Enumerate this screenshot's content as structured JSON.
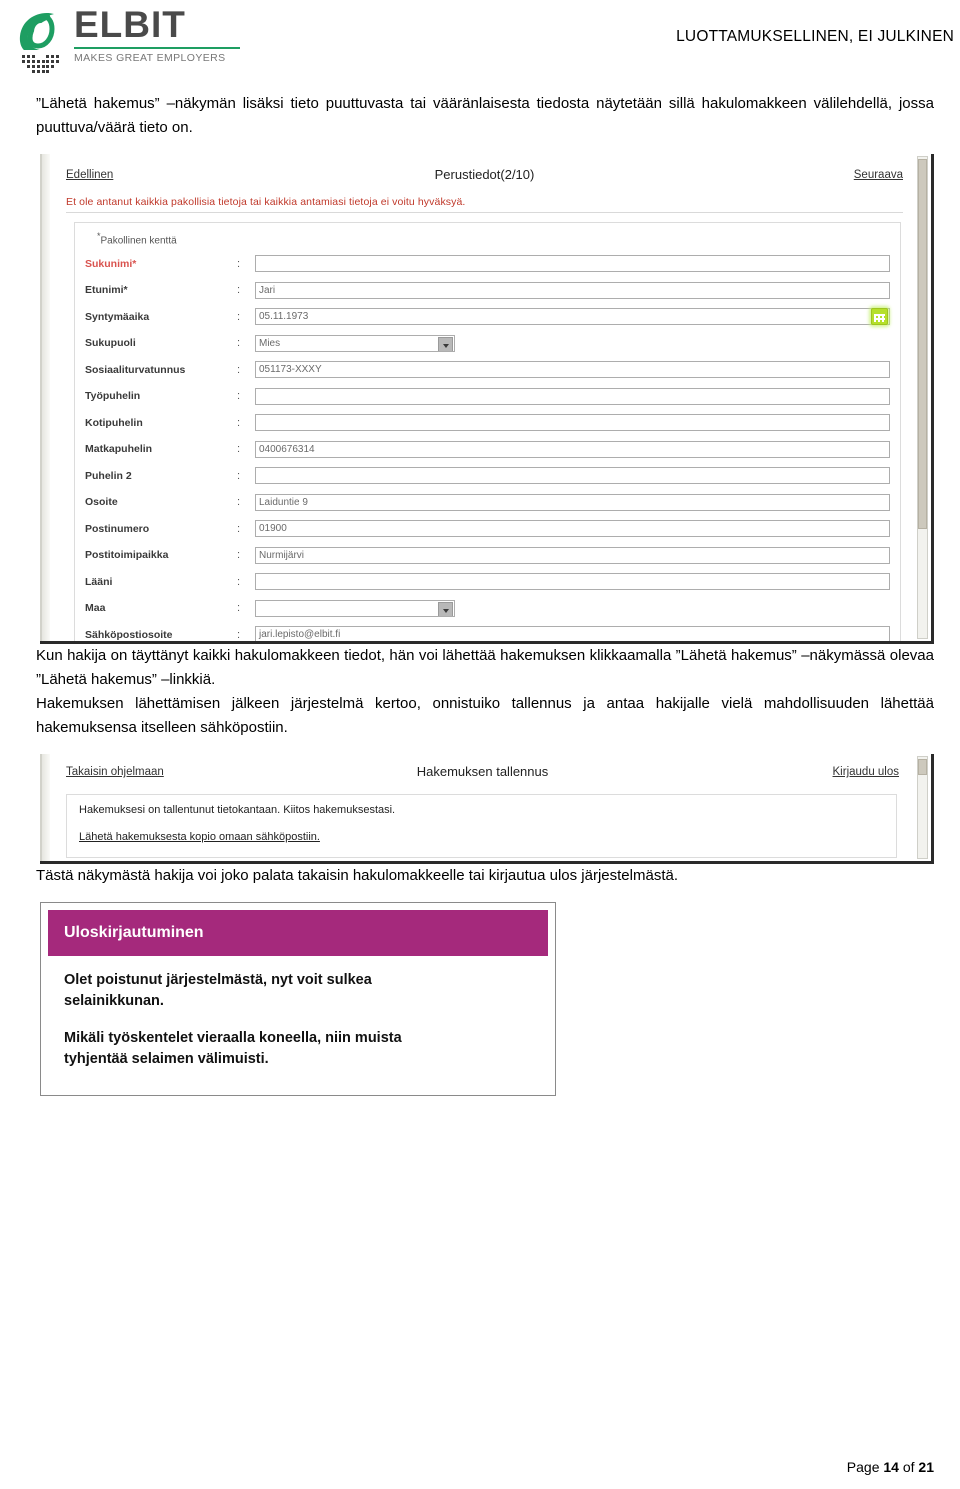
{
  "header": {
    "logo_name": "ELBIT",
    "logo_tagline": "MAKES GREAT EMPLOYERS",
    "logo_mark_icon": "elbit-e-swirl-icon",
    "classification": "LUOTTAMUKSELLINEN, EI JULKINEN",
    "brand_green": "#1e9e62",
    "brand_gray": "#4a4a4a"
  },
  "paragraphs": {
    "p1": "”Lähetä hakemus” –näkymän lisäksi tieto puuttuvasta tai vääränlaisesta tiedosta näytetään sillä hakulomakkeen välilehdellä, jossa puuttuva/väärä tieto on.",
    "p2": "Kun hakija on täyttänyt kaikki hakulomakkeen tiedot, hän voi lähettää hakemuksen klikkaamalla ”Lähetä hakemus” –näkymässä olevaa ”Lähetä hakemus” –linkkiä.",
    "p3": "Hakemuksen lähettämisen jälkeen järjestelmä kertoo, onnistuiko tallennus ja antaa hakijalle vielä mahdollisuuden lähettää hakemuksensa itselleen sähköpostiin.",
    "p4": "Tästä näkymästä hakija voi joko palata takaisin hakulomakkeelle tai kirjautua ulos järjestelmästä."
  },
  "form_screenshot": {
    "nav": {
      "prev_label": "Edellinen",
      "title": "Perustiedot(2/10)",
      "next_label": "Seuraava"
    },
    "error_message": "Et ole antanut kaikkia pakollisia tietoja tai kaikkia antamiasi tietoja ei voitu hyväksyä.",
    "mandatory_note": "Pakollinen kenttä",
    "colon": ":",
    "calendar_icon": "calendar-icon",
    "fields": [
      {
        "label": "Sukunimi*",
        "value": "",
        "type": "text",
        "required": true
      },
      {
        "label": "Etunimi*",
        "value": "Jari",
        "type": "text",
        "required": false
      },
      {
        "label": "Syntymäaika",
        "value": "05.11.1973",
        "type": "date",
        "required": false
      },
      {
        "label": "Sukupuoli",
        "value": "Mies",
        "type": "select",
        "required": false
      },
      {
        "label": "Sosiaaliturvatunnus",
        "value": "051173-XXXY",
        "type": "text",
        "required": false
      },
      {
        "label": "Työpuhelin",
        "value": "",
        "type": "text",
        "required": false
      },
      {
        "label": "Kotipuhelin",
        "value": "",
        "type": "text",
        "required": false
      },
      {
        "label": "Matkapuhelin",
        "value": "0400676314",
        "type": "text",
        "required": false
      },
      {
        "label": "Puhelin 2",
        "value": "",
        "type": "text",
        "required": false
      },
      {
        "label": "Osoite",
        "value": "Laiduntie 9",
        "type": "text",
        "required": false
      },
      {
        "label": "Postinumero",
        "value": "01900",
        "type": "text",
        "required": false
      },
      {
        "label": "Postitoimipaikka",
        "value": "Nurmijärvi",
        "type": "text",
        "required": false
      },
      {
        "label": "Lääni",
        "value": "",
        "type": "text",
        "required": false
      },
      {
        "label": "Maa",
        "value": "",
        "type": "select",
        "required": false
      },
      {
        "label": "Sähköpostiosoite",
        "value": "jari.lepisto@elbit.fi",
        "type": "text",
        "required": false
      }
    ]
  },
  "save_screenshot": {
    "nav": {
      "back_label": "Takaisin ohjelmaan",
      "title": "Hakemuksen tallennus",
      "logout_label": "Kirjaudu ulos"
    },
    "message": "Hakemuksesi on tallentunut tietokantaan.  Kiitos hakemuksestasi.",
    "email_copy_link": "Lähetä hakemuksesta kopio omaan sähköpostiin."
  },
  "logout_screenshot": {
    "header_title": "Uloskirjautuminen",
    "header_color": "#a5297c",
    "line1": "Olet poistunut järjestelmästä, nyt voit sulkea selainikkunan.",
    "line2": "Mikäli työskentelet vieraalla koneella, niin muista tyhjentää selaimen välimuisti."
  },
  "footer": {
    "page_label": "Page",
    "page_number": "14",
    "of_label": "of",
    "total_pages": "21"
  }
}
